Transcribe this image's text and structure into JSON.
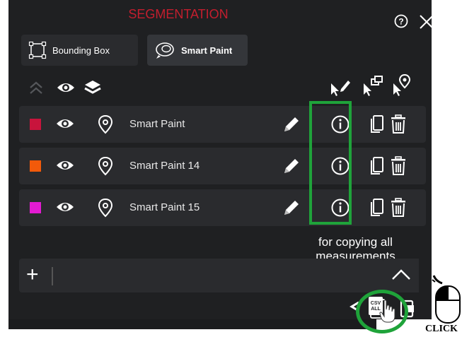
{
  "header": {
    "title": "SEGMENTATION"
  },
  "tools": [
    {
      "label": "Bounding Box"
    },
    {
      "label": "Smart Paint"
    }
  ],
  "segments": [
    {
      "name": "Smart Paint",
      "color": "#c8143c"
    },
    {
      "name": "Smart Paint 14",
      "color": "#f25a0a"
    },
    {
      "name": "Smart Paint 15",
      "color": "#e31bd2"
    }
  ],
  "annotation": {
    "note_line1": "for copying all",
    "note_line2": "measurements",
    "click_label": "CLICK"
  },
  "colors": {
    "title": "#c41e2e",
    "highlight": "#1fa33a",
    "panel": "#1f2022"
  }
}
